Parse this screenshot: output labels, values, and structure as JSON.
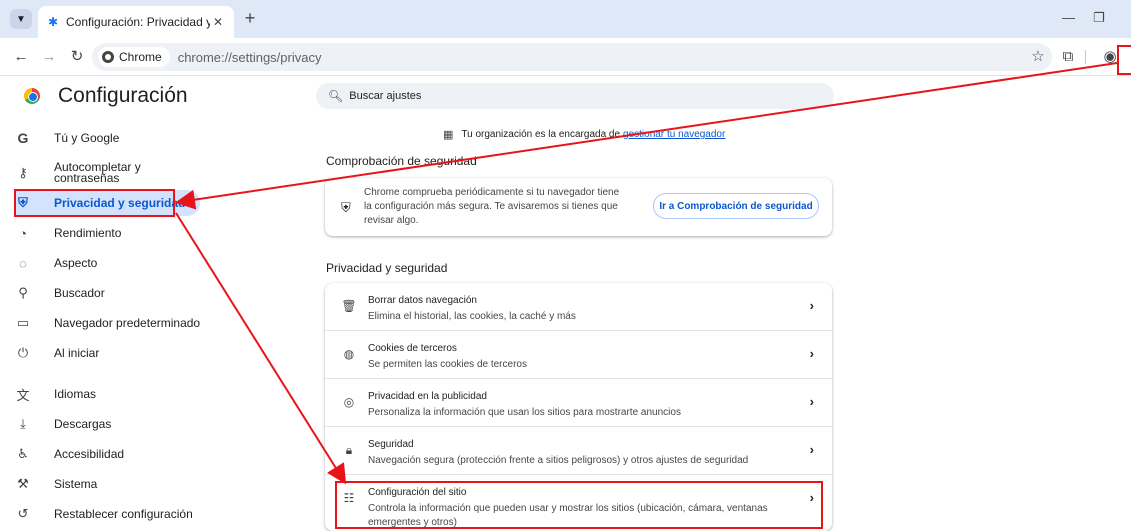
{
  "browser": {
    "tab_title": "Configuración: Privacidad y seg",
    "tab_close": "✕",
    "new_tab": "+",
    "chip_label": "Chrome",
    "url": "chrome://settings/privacy"
  },
  "settings": {
    "title": "Configuración",
    "search_placeholder": "Buscar ajustes"
  },
  "sidebar": {
    "items": [
      {
        "label": "Tú y Google",
        "icon": "google-g-icon"
      },
      {
        "label": "Autocompletar y contraseñas",
        "icon": "key-icon"
      },
      {
        "label": "Privacidad y seguridad",
        "icon": "shield-icon",
        "active": true
      },
      {
        "label": "Rendimiento",
        "icon": "speedometer-icon"
      },
      {
        "label": "Aspecto",
        "icon": "palette-icon"
      },
      {
        "label": "Buscador",
        "icon": "search-icon"
      },
      {
        "label": "Navegador predeterminado",
        "icon": "browser-window-icon"
      },
      {
        "label": "Al iniciar",
        "icon": "power-icon"
      },
      {
        "label": "Idiomas",
        "icon": "translate-icon"
      },
      {
        "label": "Descargas",
        "icon": "download-icon"
      },
      {
        "label": "Accesibilidad",
        "icon": "accessibility-icon"
      },
      {
        "label": "Sistema",
        "icon": "wrench-icon"
      },
      {
        "label": "Restablecer configuración",
        "icon": "reset-icon"
      }
    ]
  },
  "main": {
    "managed_text": "Tu organización es la encargada de",
    "managed_link": "gestionar tu navegador",
    "safety_check": {
      "section_title": "Comprobación de seguridad",
      "description": "Chrome comprueba periódicamente si tu navegador tiene la configuración más segura. Te avisaremos si tienes que revisar algo.",
      "button_label": "Ir a Comprobación de seguridad"
    },
    "privacy": {
      "section_title": "Privacidad y seguridad",
      "rows": [
        {
          "title": "Borrar datos navegación",
          "subtitle": "Elimina el historial, las cookies, la caché y más",
          "icon": "trash-icon"
        },
        {
          "title": "Cookies de terceros",
          "subtitle": "Se permiten las cookies de terceros",
          "icon": "cookie-icon"
        },
        {
          "title": "Privacidad en la publicidad",
          "subtitle": "Personaliza la información que usan los sitios para mostrarte anuncios",
          "icon": "ads-icon"
        },
        {
          "title": "Seguridad",
          "subtitle": "Navegación segura (protección frente a sitios peligrosos) y otros ajustes de seguridad",
          "icon": "lock-icon"
        },
        {
          "title": "Configuración del sitio",
          "subtitle": "Controla la información que pueden usar y mostrar los sitios (ubicación, cámara, ventanas emergentes y otros)",
          "icon": "sliders-icon"
        }
      ]
    }
  },
  "colors": {
    "accent": "#0b57d0",
    "annotation": "#e8141a",
    "active_bg": "#d3e3fd"
  }
}
